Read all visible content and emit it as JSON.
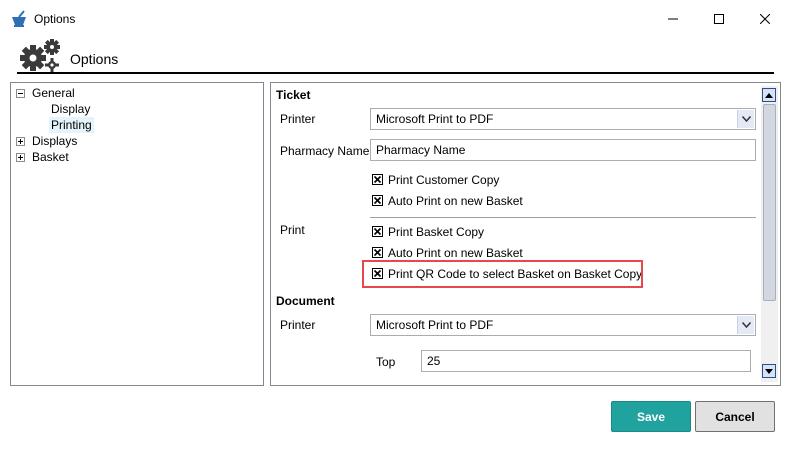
{
  "window": {
    "title": "Options"
  },
  "header": {
    "title": "Options"
  },
  "tree": {
    "general": "General",
    "display": "Display",
    "printing": "Printing",
    "displays": "Displays",
    "basket": "Basket"
  },
  "ticket": {
    "section": "Ticket",
    "printer_label": "Printer",
    "printer_value": "Microsoft Print to PDF",
    "pharmacy_label": "Pharmacy Name",
    "pharmacy_value": "Pharmacy Name",
    "print_customer_copy": "Print Customer Copy",
    "auto_print_new_basket": "Auto Print on new Basket",
    "print_label": "Print",
    "print_basket_copy": "Print Basket Copy",
    "auto_print_new_basket_2": "Auto Print on new Basket",
    "print_qr_code": "Print QR Code to select Basket on Basket Copy"
  },
  "document": {
    "section": "Document",
    "printer_label": "Printer",
    "printer_value": "Microsoft Print to PDF",
    "top_label": "Top",
    "top_value": "25"
  },
  "buttons": {
    "save": "Save",
    "cancel": "Cancel"
  },
  "colors": {
    "accent": "#20a39f",
    "highlight": "#e8474f"
  }
}
